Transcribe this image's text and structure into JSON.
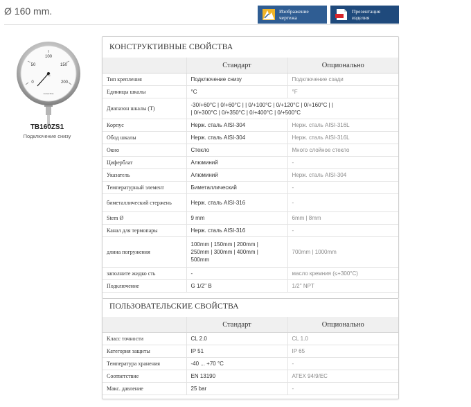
{
  "header": {
    "diameter": "Ø 160 mm.",
    "drawing_button": [
      "Изображение",
      "чертежа"
    ],
    "presentation_button": [
      "Презентация",
      "изделия"
    ]
  },
  "product": {
    "model": "TB160ZS1",
    "subtitle": "Подключение снизу",
    "gauge": {
      "scale_labels": [
        "0",
        "50",
        "100",
        "150",
        "200"
      ],
      "unit": "°C",
      "brand": "nuova fima"
    }
  },
  "construction": {
    "title": "КОНСТРУКТИВНЫЕ СВОЙСТВА",
    "col_standard": "Стандарт",
    "col_optional": "Опционально",
    "rows": [
      {
        "label": "Тип крепления",
        "std": [
          "Подключение снизу"
        ],
        "opt": [
          "Подключение сзади"
        ]
      },
      {
        "label": "Единицы шкалы",
        "std": [
          "°C"
        ],
        "opt": [
          "°F"
        ]
      },
      {
        "label": "Диапазон шкалы (T)",
        "std": [
          "-30/+60°C  |  0/+60°C  |   |  0/+100°C  |  0/+120°C  |  0/+160°C  |   |",
          "|  0/+300°C  |  0/+350°C  |  0/+400°C  |  0/+500°C"
        ],
        "opt": []
      },
      {
        "label": "Корпус",
        "std": [
          "Нерж. сталь AISI-304"
        ],
        "opt": [
          "Нерж. сталь AISI-316L"
        ]
      },
      {
        "label": "Обод шкалы",
        "std": [
          "Нерж. сталь AISI-304"
        ],
        "opt": [
          "Нерж. сталь AISI-316L"
        ]
      },
      {
        "label": "Окно",
        "std": [
          "Стекло"
        ],
        "opt": [
          "Много слойное стекло"
        ]
      },
      {
        "label": "Циферблат",
        "std": [
          "Алюминий"
        ],
        "opt": [
          "-"
        ]
      },
      {
        "label": "Указатель",
        "std": [
          "Алюминий"
        ],
        "opt": [
          "Нерж. сталь AISI-304"
        ]
      },
      {
        "label": "Температурный элемент",
        "std": [
          "Биметаллический"
        ],
        "opt": [
          "-"
        ]
      },
      {
        "label": "биметаллический стержень",
        "std": [
          "Нерж. сталь AISI-316"
        ],
        "opt": [
          "-"
        ]
      },
      {
        "label": "Stem Ø",
        "std": [
          "9 mm"
        ],
        "opt": [
          "6mm  |  8mm"
        ]
      },
      {
        "label": "Канал для термопары",
        "std": [
          "Нерж. сталь AISI-316"
        ],
        "opt": [
          "-"
        ]
      },
      {
        "label": "длина погружения",
        "std": [
          "100mm  |  150mm  |  200mm  |",
          "250mm  |  300mm  |  400mm  |",
          "500mm"
        ],
        "opt": [
          "700mm  |  1000mm"
        ]
      },
      {
        "label": "заполните жидко сть",
        "std": [
          "-"
        ],
        "opt": [
          "масло кремния (≤+300°C)"
        ]
      },
      {
        "label": "Подключение",
        "std": [
          "G 1/2'' B"
        ],
        "opt": [
          "1/2'' NPT"
        ]
      }
    ]
  },
  "user": {
    "title": "ПОЛЬЗОВАТЕЛЬСКИЕ СВОЙСТВА",
    "col_standard": "Стандарт",
    "col_optional": "Опционально",
    "rows": [
      {
        "label": "Класс точности",
        "std": [
          "CL 2.0"
        ],
        "opt": [
          "CL 1.0"
        ]
      },
      {
        "label": "Категория защиты",
        "std": [
          "IP 51"
        ],
        "opt": [
          "IP 65"
        ]
      },
      {
        "label": "Температура хранения",
        "std": [
          "-40 ... +70 °C"
        ],
        "opt": [
          "-"
        ]
      },
      {
        "label": "Соответствие",
        "std": [
          "EN 13190"
        ],
        "opt": [
          "ATEX 94/9/EC"
        ]
      },
      {
        "label": "Макс. давление",
        "std": [
          "25 bar"
        ],
        "opt": [
          "-"
        ]
      }
    ]
  }
}
